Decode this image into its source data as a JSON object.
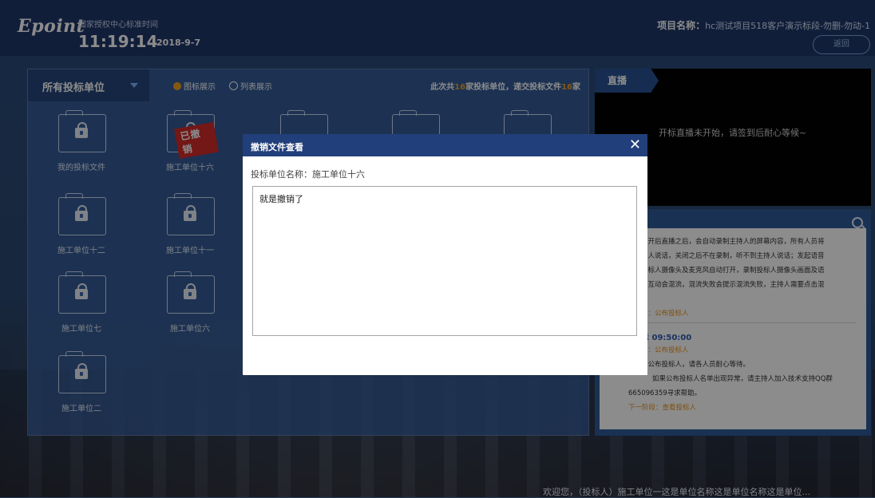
{
  "header": {
    "logo": "Epoint",
    "std_time_label": "国家授权中心标准时间",
    "time": "11:19:14",
    "date": "2018-9-7",
    "project_label": "项目名称：",
    "project_value": "hc测试项目518客户演示标段-勿删-勿动-1",
    "back_label": "返回"
  },
  "bidders_panel": {
    "dropdown_label": "所有投标单位",
    "view_icon_label": "图标展示",
    "view_list_label": "列表展示",
    "count_prefix": "此次共",
    "count_units": "16",
    "count_mid": "家投标单位，递交投标文件",
    "count_files": "16",
    "count_suffix": "家",
    "withdrawn_stamp": "已撤销",
    "folders": [
      {
        "name": "我的投标文件"
      },
      {
        "name": "施工单位十六"
      },
      {
        "name": "施工单位十二"
      },
      {
        "name": "施工单位十一"
      },
      {
        "name": "施工单位七"
      },
      {
        "name": "施工单位六"
      },
      {
        "name": "施工单位二"
      }
    ]
  },
  "live": {
    "tab_label": "直播",
    "message": "开标直播未开始，请签到后耐心等候~"
  },
  "log": {
    "lines": [
      "打开后直播之后，会自动录制主持人的屏幕内容，所有人员将",
      "持人说话，关闭之后不在录制，听不到主持人说话；发起语音",
      "投标人摄像头及麦克风自动打开，录制投标人摄像头画面及语",
      "音互动会混流，混流失败会提示混流失败，主持人需要点击混",
      "段：公布投标人",
      "示 09:50:00",
      "段：公布投标人",
      "在公布投标人，请各人员耐心等待。",
      "如果公布投标人名单出现异常，请主持人加入技术支持QQ群",
      "665096359寻求帮助。",
      "下一阶段：查看投标人"
    ]
  },
  "footer": {
    "welcome": "欢迎您，（投标人）施工单位一这是单位名称这是单位名称这是单位..."
  },
  "modal": {
    "title": "撤销文件查看",
    "close_icon": "close-icon",
    "unit_label": "投标单位名称：施工单位十六",
    "reason_text": "就是撤销了"
  },
  "colors": {
    "header_bg": "#20386a",
    "accent_orange": "#f2a11e",
    "stamp_red": "#d32a2a",
    "modal_header": "#213f7a"
  }
}
